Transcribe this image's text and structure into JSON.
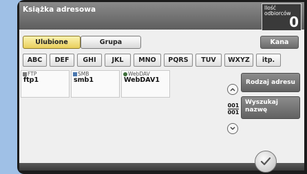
{
  "header": {
    "title": "Książka adresowa"
  },
  "recipients": {
    "label": "Ilość odbiorców",
    "count": "0"
  },
  "tabs": {
    "favorites": "Ulubione",
    "group": "Grupa",
    "kana": "Kana"
  },
  "index_keys": [
    "ABC",
    "DEF",
    "GHI",
    "JKL",
    "MNO",
    "PQRS",
    "TUV",
    "WXYZ",
    "itp."
  ],
  "entries": [
    {
      "type": "FTP",
      "name": "ftp1",
      "icon": "ftp-icon"
    },
    {
      "type": "SMB",
      "name": "smb1",
      "icon": "smb-icon"
    },
    {
      "type": "WebDAV",
      "name": "WebDAV1",
      "icon": "webdav-icon"
    }
  ],
  "pagination": {
    "current": "001",
    "total": "001"
  },
  "side_buttons": {
    "address_type": "Rodzaj adresu",
    "search_name": "Wyszukaj nazwę"
  },
  "colors": {
    "active_tab": "#f3e28a",
    "header": "#6e6e6e",
    "background": "#9fc0e6"
  }
}
